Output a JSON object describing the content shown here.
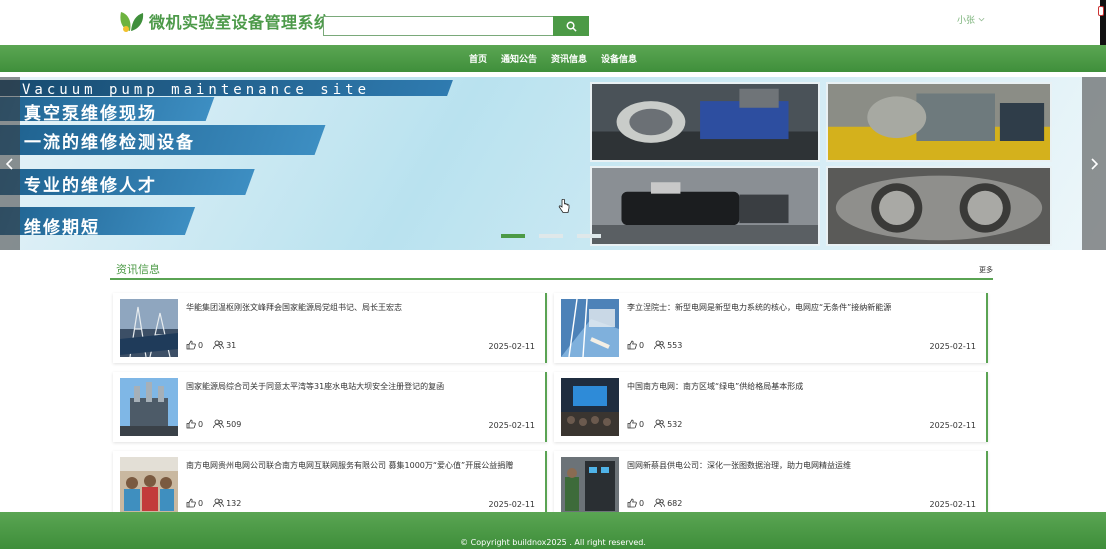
{
  "header": {
    "site_title": "微机实验室设备管理系统",
    "search_placeholder": "",
    "user_name": "小张"
  },
  "nav": [
    {
      "label": "首页"
    },
    {
      "label": "通知公告"
    },
    {
      "label": "资讯信息"
    },
    {
      "label": "设备信息"
    }
  ],
  "banner": {
    "english_line": "Vacuum pump maintenance site",
    "lines": [
      "真空泵维修现场",
      "一流的维修检测设备",
      "专业的维修人才",
      "维修期短"
    ],
    "slide_count": 3,
    "active_slide": 1
  },
  "news_section": {
    "title": "资讯信息",
    "more_label": "更多",
    "items": [
      {
        "title": "华能集团温枢刚张文峰拜会国家能源局党组书记、局长王宏志",
        "likes": "0",
        "views": "31",
        "date": "2025-02-11"
      },
      {
        "title": "李立浧院士：新型电网是新型电力系统的核心，电网应“无条件”接纳新能源",
        "likes": "0",
        "views": "553",
        "date": "2025-02-11"
      },
      {
        "title": "国家能源局综合司关于同意太平湾等31座水电站大坝安全注册登记的复函",
        "likes": "0",
        "views": "509",
        "date": "2025-02-11"
      },
      {
        "title": "中国南方电网：南方区域“绿电”供给格局基本形成",
        "likes": "0",
        "views": "532",
        "date": "2025-02-11"
      },
      {
        "title": "南方电网贵州电网公司联合南方电网互联网服务有限公司 募集1000万“爱心值”开展公益捐赠",
        "likes": "0",
        "views": "132",
        "date": "2025-02-11"
      },
      {
        "title": "国网新蔡县供电公司：深化一张图数据治理，助力电网精益运维",
        "likes": "0",
        "views": "682",
        "date": "2025-02-11"
      }
    ]
  },
  "footer": {
    "copyright": "© Copyright buildnox2025 . All right reserved."
  },
  "colors": {
    "brand_green": "#4c9a46",
    "nav_green": "#5ba653"
  }
}
